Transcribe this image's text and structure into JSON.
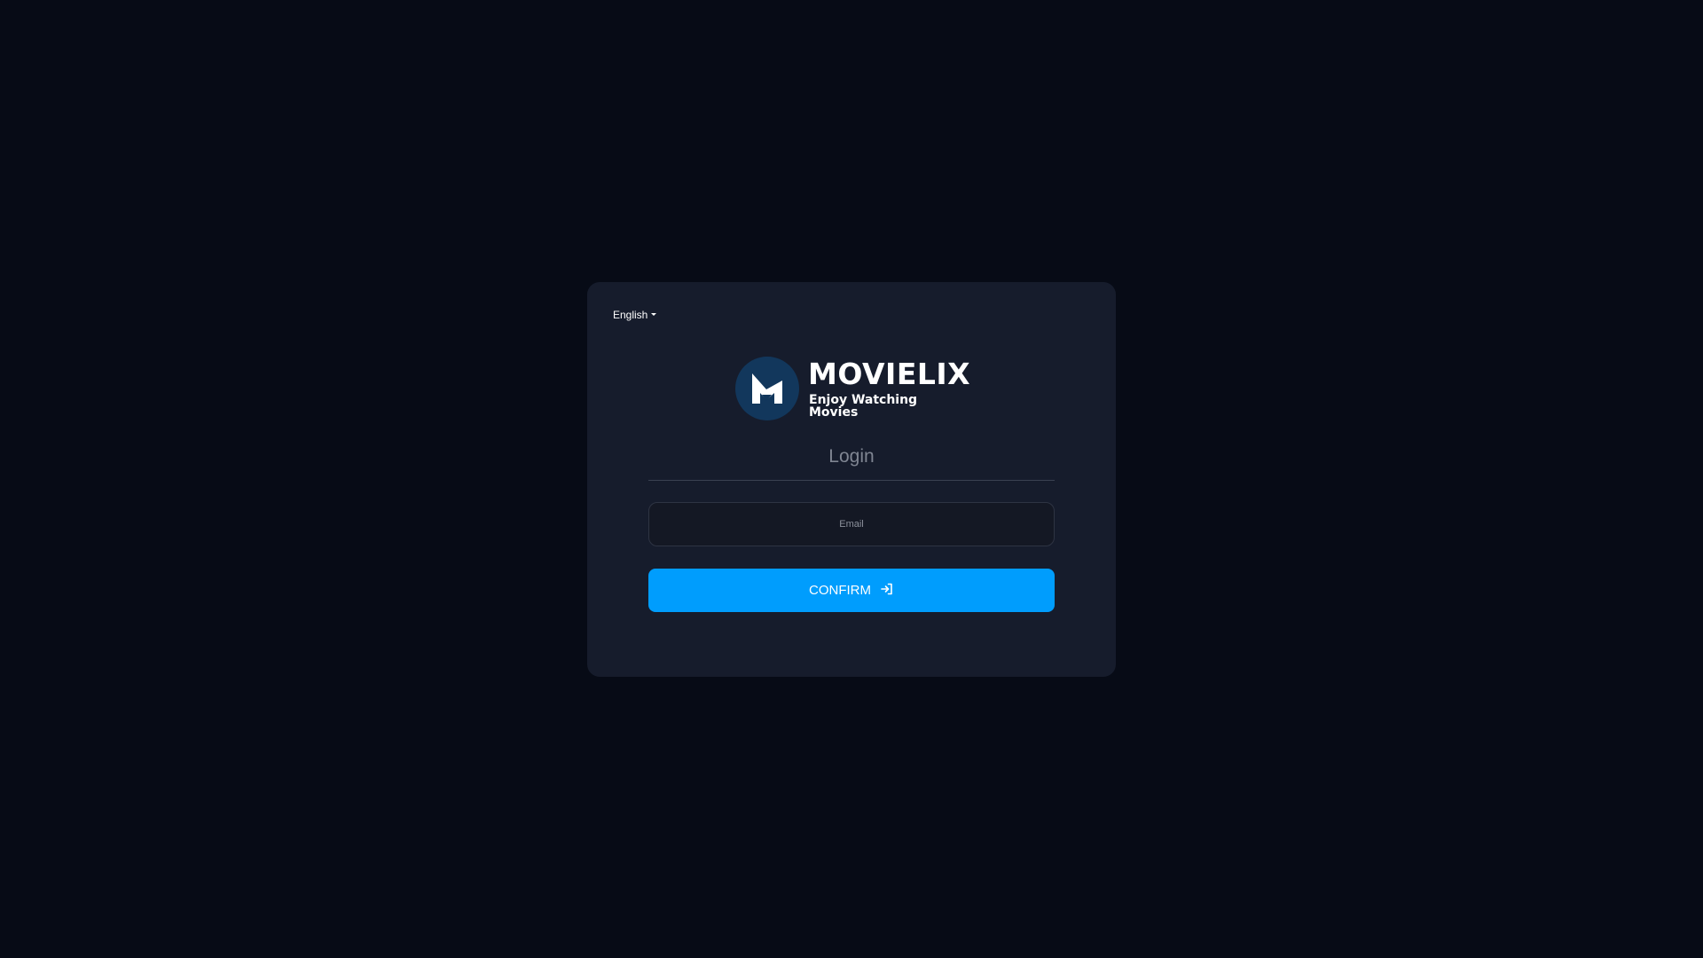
{
  "language": {
    "selected": "English"
  },
  "logo": {
    "name": "MOVIELIX",
    "tagline": "Enjoy Watching Movies",
    "badge_color": "#12375c",
    "icon": "movielix-logo-icon"
  },
  "form": {
    "title": "Login",
    "email_placeholder": "Email",
    "email_value": "",
    "confirm_label": "CONFIRM",
    "confirm_icon": "sign-in-icon"
  },
  "colors": {
    "background": "#070b16",
    "card": "#161c2c",
    "accent": "#009dfd"
  }
}
